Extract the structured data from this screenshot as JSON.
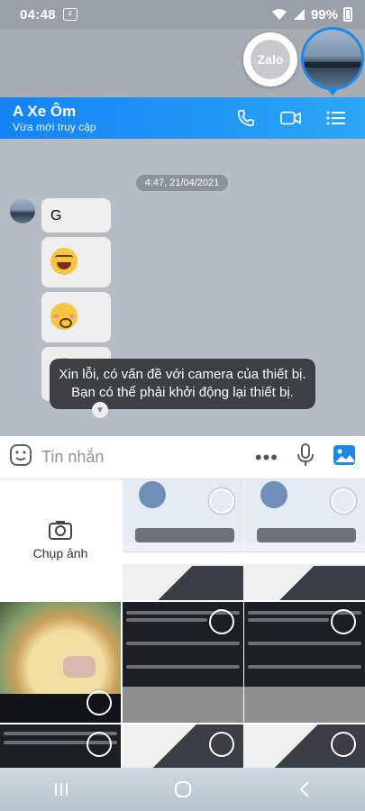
{
  "status_bar": {
    "time": "04:48",
    "battery": "99%",
    "notification_app": "Zalo"
  },
  "chat_heads": {
    "zalo_label": "Zalo"
  },
  "header": {
    "contact_name": "A Xe Ôm",
    "contact_status": "Vừa mới truy cập",
    "icons": [
      "phone-icon",
      "video-call-icon",
      "menu-list-icon"
    ],
    "accent": "#1583f5"
  },
  "chat": {
    "timestamp": "4:47, 21/04/2021",
    "messages": [
      {
        "type": "text",
        "text": "G"
      },
      {
        "type": "emoji",
        "emoji": "laughing-tears"
      },
      {
        "type": "emoji",
        "emoji": "pleading-face"
      },
      {
        "type": "emoji",
        "emoji": "partially-hidden"
      }
    ],
    "toast": "Xin lỗi, có vấn đề với camera của thiết bị. Bạn có thể phải khởi động lại thiết bị."
  },
  "input_bar": {
    "placeholder": "Tin nhắn",
    "icons": [
      "sticker-icon",
      "more-icon",
      "microphone-icon",
      "image-icon"
    ]
  },
  "gallery": {
    "camera_label": "Chụp ảnh",
    "thumbnails": [
      "chat-screenshot",
      "chat-screenshot",
      "food-photo",
      "news-screenshot",
      "news-screenshot",
      "news-screenshot",
      "screenshot",
      "screenshot"
    ]
  },
  "nav_bar": {
    "buttons": [
      "recents-icon",
      "home-icon",
      "back-icon"
    ]
  }
}
